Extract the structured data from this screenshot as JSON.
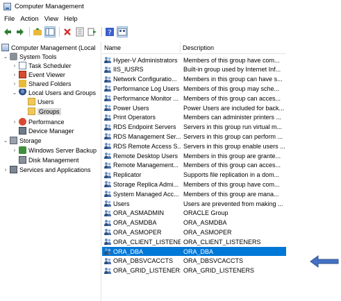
{
  "window": {
    "title": "Computer Management",
    "icon": "computer-management-icon"
  },
  "menu": [
    "File",
    "Action",
    "View",
    "Help"
  ],
  "toolbar": {
    "buttons": [
      "back-arrow-icon",
      "forward-arrow-icon",
      "up-folder-icon",
      "show-hide-tree-icon",
      "delete-icon",
      "properties-icon",
      "export-list-icon",
      "help-icon",
      "view-icon"
    ]
  },
  "tree": {
    "items": [
      {
        "label": "Computer Management (Local",
        "icon": "computer-management-icon",
        "expander": "",
        "level": 0
      },
      {
        "label": "System Tools",
        "icon": "system-tools-icon",
        "expander": "⌄",
        "level": 1
      },
      {
        "label": "Task Scheduler",
        "icon": "task-scheduler-icon",
        "expander": "›",
        "level": 2
      },
      {
        "label": "Event Viewer",
        "icon": "event-viewer-icon",
        "expander": "›",
        "level": 2
      },
      {
        "label": "Shared Folders",
        "icon": "shared-folders-icon",
        "expander": "›",
        "level": 2
      },
      {
        "label": "Local Users and Groups",
        "icon": "local-users-groups-icon",
        "expander": "⌄",
        "level": 2
      },
      {
        "label": "Users",
        "icon": "folder-icon",
        "expander": "",
        "level": 3
      },
      {
        "label": "Groups",
        "icon": "folder-icon",
        "expander": "",
        "level": 3,
        "selected": true
      },
      {
        "label": "Performance",
        "icon": "performance-icon",
        "expander": "›",
        "level": 2
      },
      {
        "label": "Device Manager",
        "icon": "device-manager-icon",
        "expander": "",
        "level": 2
      },
      {
        "label": "Storage",
        "icon": "storage-icon",
        "expander": "⌄",
        "level": 1
      },
      {
        "label": "Windows Server Backup",
        "icon": "server-backup-icon",
        "expander": "›",
        "level": 2
      },
      {
        "label": "Disk Management",
        "icon": "disk-management-icon",
        "expander": "",
        "level": 2
      },
      {
        "label": "Services and Applications",
        "icon": "services-applications-icon",
        "expander": "›",
        "level": 1
      }
    ]
  },
  "list": {
    "columns": {
      "name": "Name",
      "description": "Description"
    },
    "rows": [
      {
        "name": "Hyper-V Administrators",
        "description": "Members of this group have com..."
      },
      {
        "name": "IIS_IUSRS",
        "description": "Built-in group used by Internet Inf..."
      },
      {
        "name": "Network Configuratio...",
        "description": "Members in this group can have s..."
      },
      {
        "name": "Performance Log Users",
        "description": "Members of this group may sche..."
      },
      {
        "name": "Performance Monitor ...",
        "description": "Members of this group can acces..."
      },
      {
        "name": "Power Users",
        "description": "Power Users are included for back..."
      },
      {
        "name": "Print Operators",
        "description": "Members can administer printers ..."
      },
      {
        "name": "RDS Endpoint Servers",
        "description": "Servers in this group run virtual m..."
      },
      {
        "name": "RDS Management Ser...",
        "description": "Servers in this group can perform ..."
      },
      {
        "name": "RDS Remote Access S...",
        "description": "Servers in this group enable users ..."
      },
      {
        "name": "Remote Desktop Users",
        "description": "Members in this group are grante..."
      },
      {
        "name": "Remote Management...",
        "description": "Members of this group can acces..."
      },
      {
        "name": "Replicator",
        "description": "Supports file replication in a dom..."
      },
      {
        "name": "Storage Replica Admi...",
        "description": "Members of this group have com..."
      },
      {
        "name": "System Managed Acc...",
        "description": "Members of this group are mana..."
      },
      {
        "name": "Users",
        "description": "Users are prevented from making ..."
      },
      {
        "name": "ORA_ASMADMIN",
        "description": "ORACLE Group"
      },
      {
        "name": "ORA_ASMDBA",
        "description": "ORA_ASMDBA"
      },
      {
        "name": "ORA_ASMOPER",
        "description": "ORA_ASMOPER"
      },
      {
        "name": "ORA_CLIENT_LISTENE...",
        "description": "ORA_CLIENT_LISTENERS"
      },
      {
        "name": "ORA_DBA",
        "description": "ORA_DBA",
        "selected": true
      },
      {
        "name": "ORA_DBSVCACCTS",
        "description": "ORA_DBSVCACCTS"
      },
      {
        "name": "ORA_GRID_LISTENERS",
        "description": "ORA_GRID_LISTENERS"
      }
    ]
  },
  "annotation": {
    "icon": "left-arrow-icon",
    "color": "#4472c4"
  },
  "colors": {
    "selection": "#0078d7",
    "tree_selection": "#d9d9d9"
  }
}
